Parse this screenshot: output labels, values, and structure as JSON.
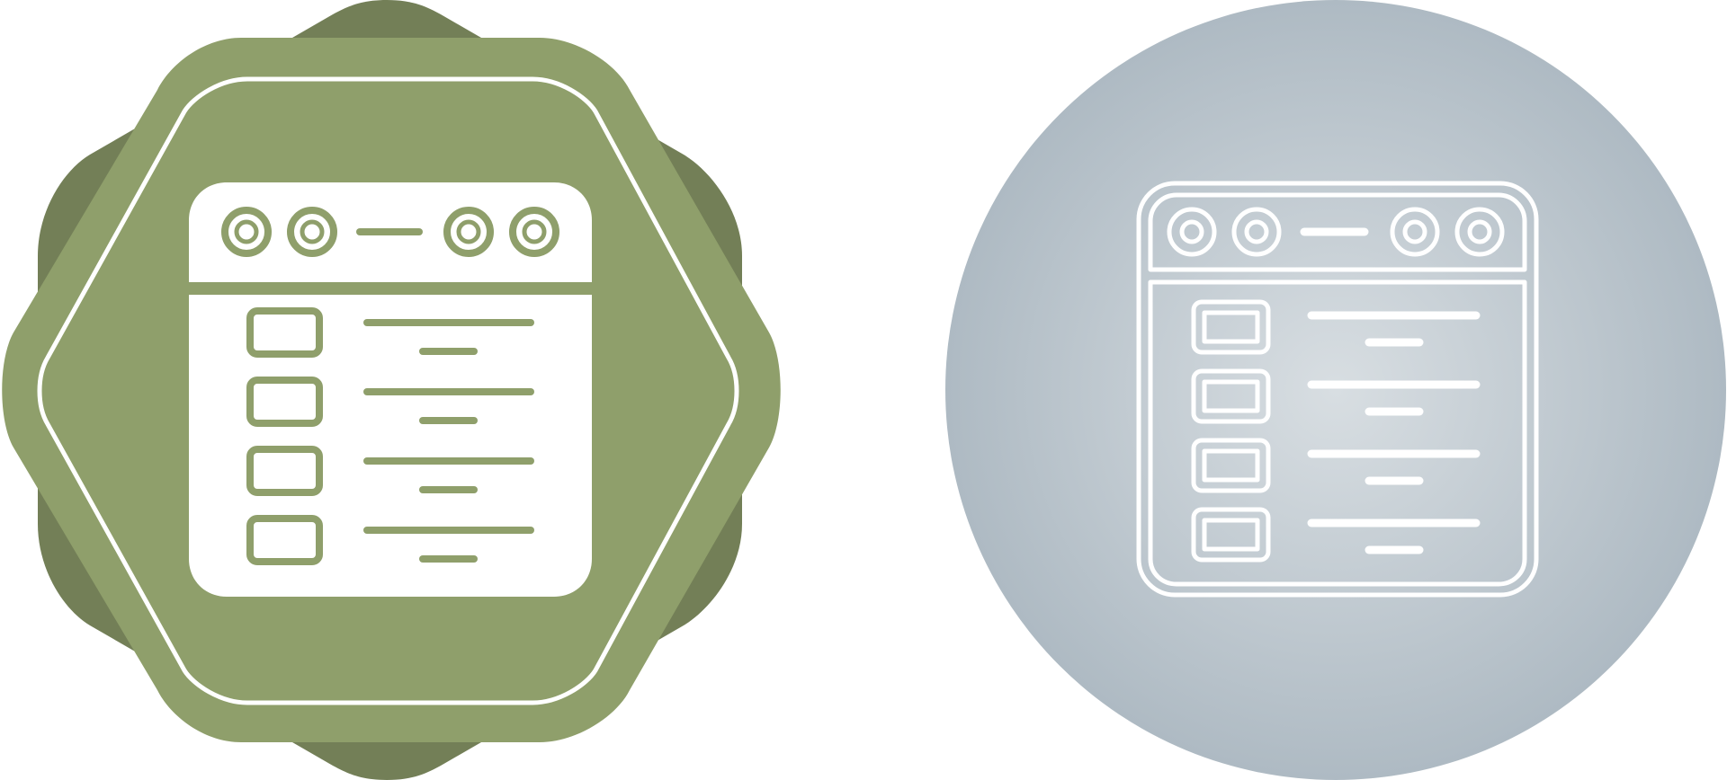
{
  "icons": [
    {
      "name": "browser-list-glyph-icon",
      "style": "glyph",
      "badge_shape": "octagon-badge",
      "colors": {
        "badge_back": "#737f57",
        "badge_front": "#8f9f6b",
        "symbol": "#ffffff",
        "detail": "#8f9f6b"
      },
      "rows": 4
    },
    {
      "name": "browser-list-line-icon",
      "style": "line",
      "badge_shape": "circle-badge",
      "colors": {
        "gradient_center": "#d8dee2",
        "gradient_edge": "#aebac3",
        "stroke": "#ffffff"
      },
      "rows": 4
    }
  ]
}
